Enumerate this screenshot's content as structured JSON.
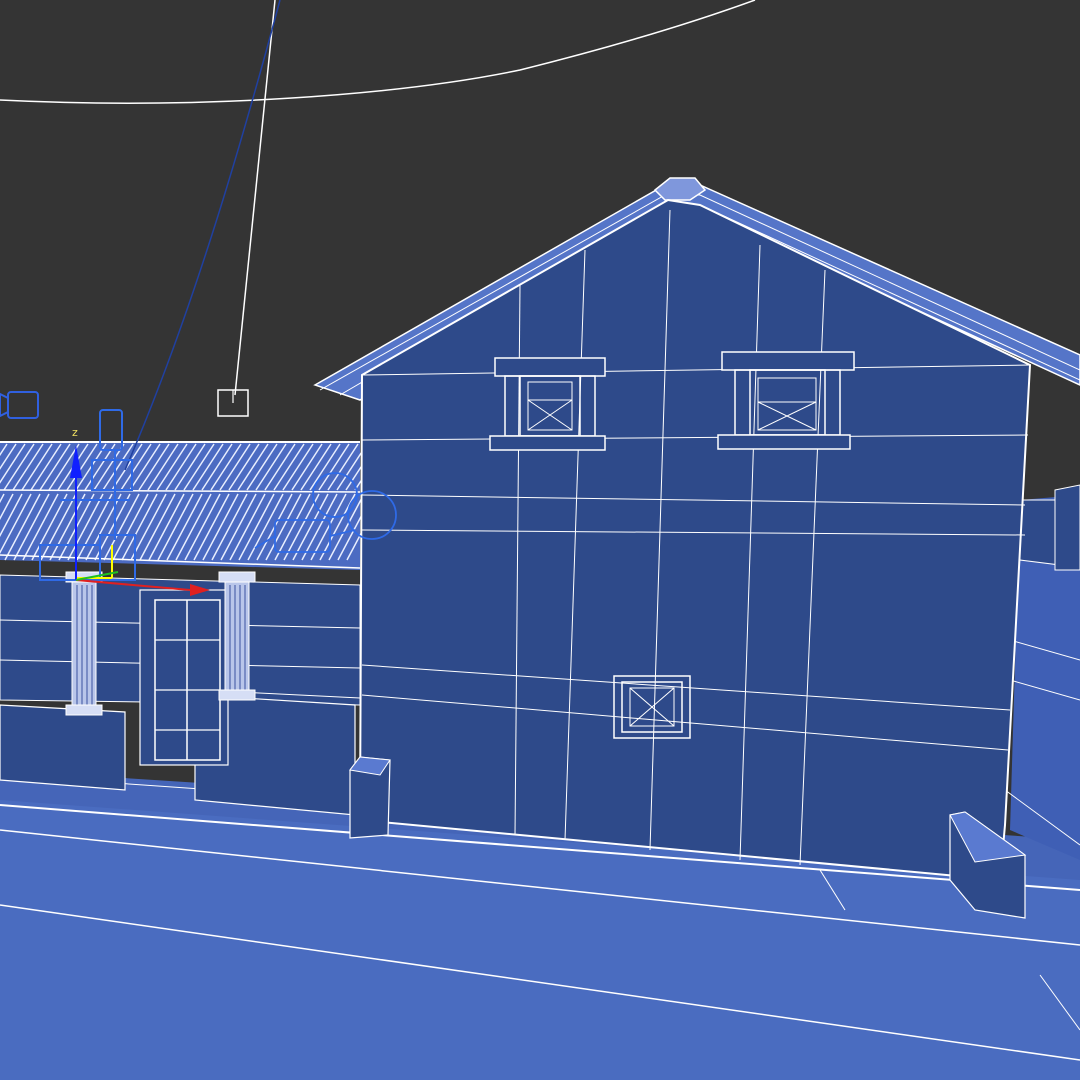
{
  "viewport": {
    "background": "#343434",
    "wire_color": "#ffffff",
    "mesh_fill": "#2e4a8a",
    "ground_fill": "#4565b8",
    "gizmo": {
      "z_label": "z",
      "z_color": "#1020ff",
      "x_color": "#e02020",
      "y_color": "#20c020"
    },
    "icons": [
      "camera-icon",
      "light-icon",
      "helper-box-icon",
      "transform-gizmo-icon"
    ]
  }
}
